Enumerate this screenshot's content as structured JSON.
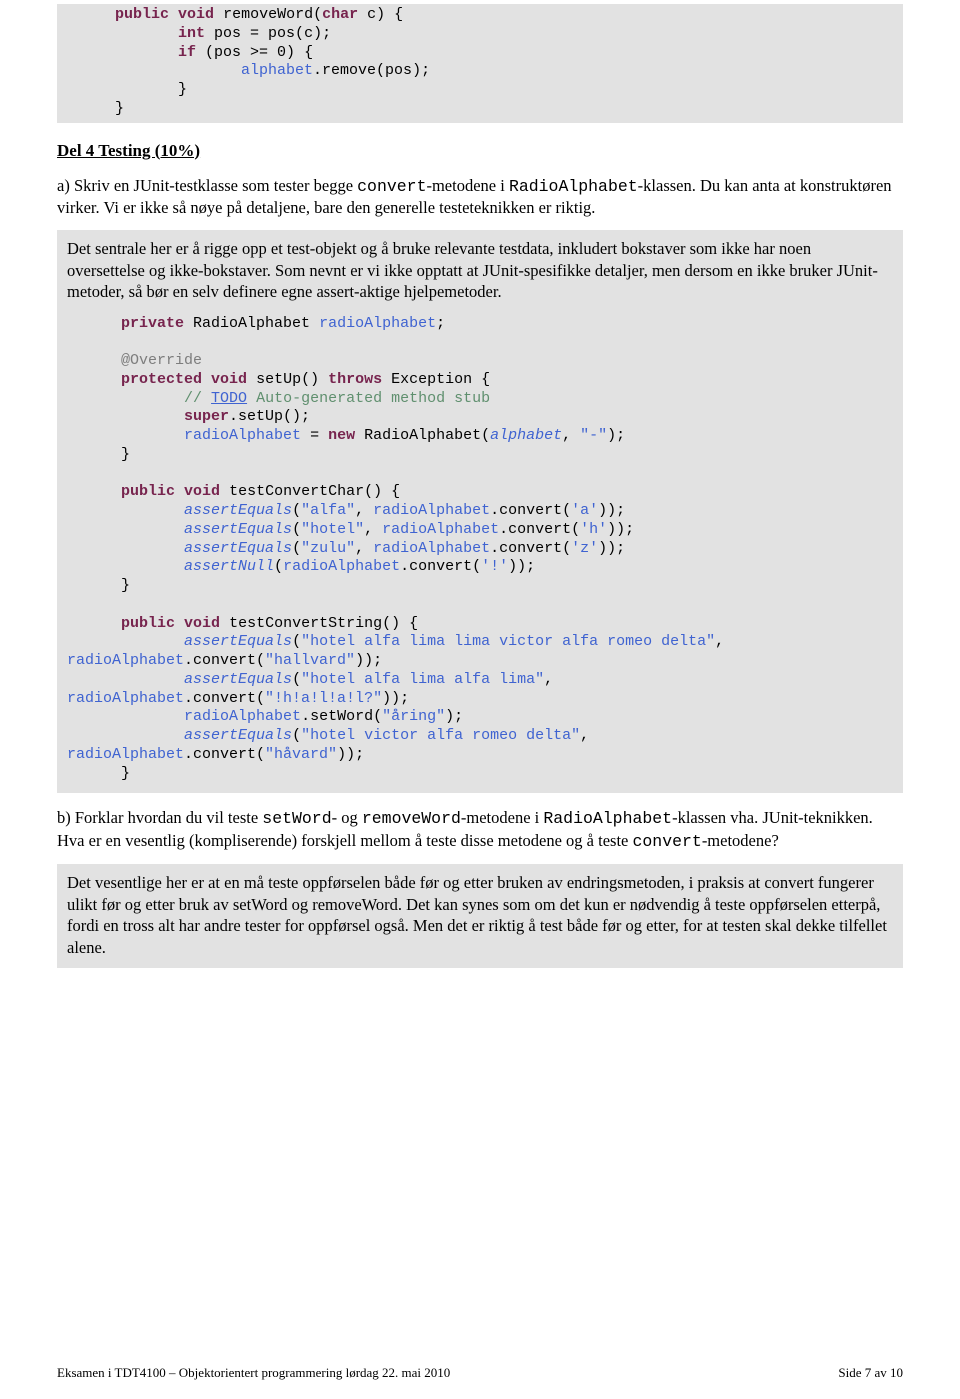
{
  "code1": {
    "t1a": "public",
    "t1b": "void",
    "t1c": " removeWord(",
    "t1d": "char",
    "t1e": " c) {",
    "t2a": "int",
    "t2b": " pos = pos(c);",
    "t3a": "if",
    "t3b": " (pos >= 0) {",
    "t4a": "alphabet",
    "t4b": ".remove(pos);",
    "t5": "}",
    "t6": "}"
  },
  "section": "Del 4 Testing (10%)",
  "p1": {
    "a": "a) Skriv en JUnit-testklasse som tester begge ",
    "b": "convert",
    "c": "-metodene i ",
    "d": "RadioAlphabet",
    "e": "-klassen. Du kan anta at konstruktøren virker. Vi er ikke så nøye på detaljene, bare den generelle testeteknikken er riktig."
  },
  "g1": {
    "a": "Det sentrale her er å rigge opp et test-objekt og å bruke relevante testdata, inkludert bokstaver som ikke har noen oversettelse og ikke-bokstaver. Som nevnt er vi ikke opptatt at JUnit-spesifikke detaljer, men dersom en ikke bruker JUnit-metoder, så bør en selv definere egne assert-aktige hjelpemetoder."
  },
  "code2": {
    "l1a": "private",
    "l1b": " RadioAlphabet ",
    "l1c": "radioAlphabet",
    "l1d": ";",
    "l2": "@Override",
    "l3a": "protected",
    "l3b": "void",
    "l3c": " setUp() ",
    "l3d": "throws",
    "l3e": " Exception {",
    "l4a": "// ",
    "l4b": "TODO",
    "l4c": " Auto-generated method stub",
    "l5a": "super",
    "l5b": ".setUp();",
    "l6a": "radioAlphabet",
    "l6b": " = ",
    "l6c": "new",
    "l6d": " RadioAlphabet(",
    "l6e": "alphabet",
    "l6f": ", ",
    "l6g": "\"-\"",
    "l6h": ");",
    "l7": "}",
    "l8a": "public",
    "l8b": "void",
    "l8c": " testConvertChar() {",
    "l9a": "assertEquals",
    "l9b": "(",
    "l9c": "\"alfa\"",
    "l9d": ", ",
    "l9e": "radioAlphabet",
    "l9f": ".convert(",
    "l9g": "'a'",
    "l9h": "));",
    "l10a": "assertEquals",
    "l10b": "(",
    "l10c": "\"hotel\"",
    "l10d": ", ",
    "l10e": "radioAlphabet",
    "l10f": ".convert(",
    "l10g": "'h'",
    "l10h": "));",
    "l11a": "assertEquals",
    "l11b": "(",
    "l11c": "\"zulu\"",
    "l11d": ", ",
    "l11e": "radioAlphabet",
    "l11f": ".convert(",
    "l11g": "'z'",
    "l11h": "));",
    "l12a": "assertNull",
    "l12b": "(",
    "l12c": "radioAlphabet",
    "l12d": ".convert(",
    "l12e": "'!'",
    "l12f": "));",
    "l13": "}",
    "l14a": "public",
    "l14b": "void",
    "l14c": " testConvertString() {",
    "l15a": "assertEquals",
    "l15b": "(",
    "l15c": "\"hotel alfa lima lima victor alfa romeo delta\"",
    "l15d": ",",
    "l16a": "radioAlphabet",
    "l16b": ".convert(",
    "l16c": "\"hallvard\"",
    "l16d": "));",
    "l17a": "assertEquals",
    "l17b": "(",
    "l17c": "\"hotel alfa lima alfa lima\"",
    "l17d": ",",
    "l18a": "radioAlphabet",
    "l18b": ".convert(",
    "l18c": "\"!h!a!l!a!l?\"",
    "l18d": "));",
    "l19a": "radioAlphabet",
    "l19b": ".setWord(",
    "l19c": "\"åring\"",
    "l19d": ");",
    "l20a": "assertEquals",
    "l20b": "(",
    "l20c": "\"hotel victor alfa romeo delta\"",
    "l20d": ",",
    "l21a": "radioAlphabet",
    "l21b": ".convert(",
    "l21c": "\"håvard\"",
    "l21d": "));",
    "l22": "}"
  },
  "p2": {
    "a": "b) Forklar hvordan du vil teste ",
    "b": "setWord",
    "c": "- og ",
    "d": "removeWord",
    "e": "-metodene i ",
    "f": "RadioAlphabet",
    "g": "-klassen vha. JUnit-teknikken. Hva er en vesentlig (kompliserende) forskjell mellom å teste disse metodene og å teste ",
    "h": "convert",
    "i": "-metodene?"
  },
  "g2": "Det vesentlige her er at en må teste oppførselen både før og etter bruken av endringsmetoden, i praksis at convert fungerer ulikt før og etter bruk av setWord og removeWord. Det kan synes som om det kun er nødvendig å teste oppførselen etterpå, fordi en tross alt har andre tester for oppførsel også. Men det er riktig å test både før og etter, for at testen skal dekke tilfellet alene.",
  "footer": {
    "left": "Eksamen i TDT4100 – Objektorientert programmering lørdag 22. mai 2010",
    "right": "Side 7 av 10"
  }
}
